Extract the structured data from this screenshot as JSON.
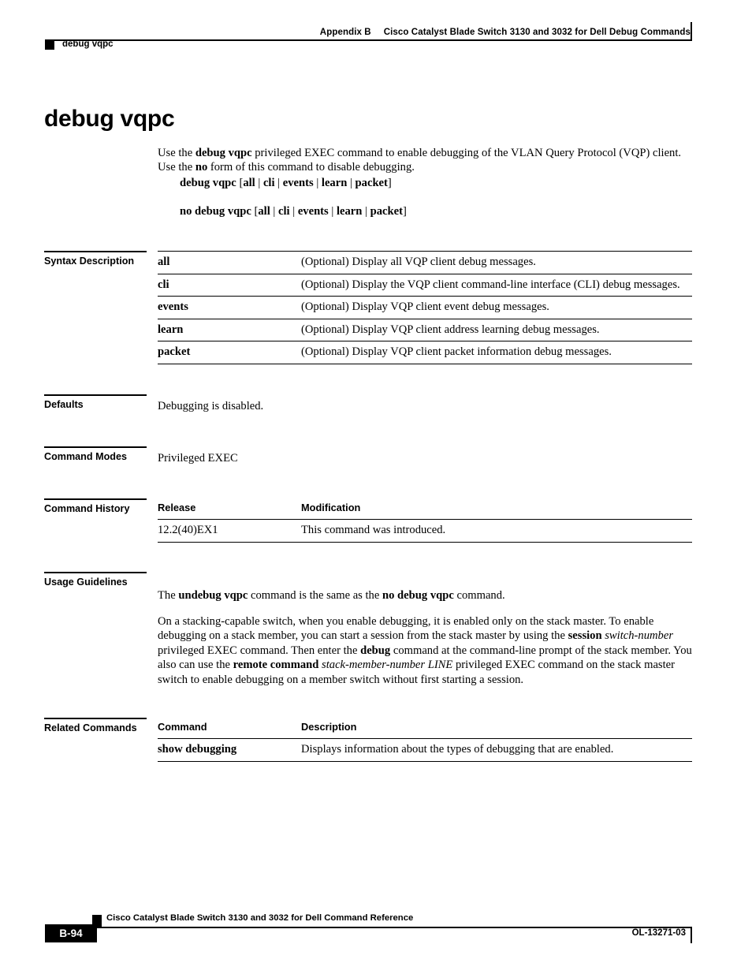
{
  "header": {
    "appendix": "Appendix B",
    "book_title": "Cisco Catalyst Blade Switch 3130 and 3032 for Dell Debug Commands",
    "running_command": "debug vqpc"
  },
  "title": "debug vqpc",
  "intro": {
    "part1": "Use the ",
    "command_bold": "debug vqpc",
    "part2": " privileged EXEC command to enable debugging of the VLAN Query Protocol (VQP) client. Use the ",
    "no_bold": "no",
    "part3": " form of this command to disable debugging."
  },
  "syntax_lines": {
    "line1": "debug vqpc [all | cli | events | learn | packet]",
    "line2": "no debug vqpc [all | cli | events | learn | packet]",
    "line1_pre": "debug vqpc ",
    "line2_pre": "no debug vqpc ",
    "bracket_open": "[",
    "bracket_close": "]",
    "bracket_sep": " | ",
    "keywords": [
      "all",
      "cli",
      "events",
      "learn",
      "packet"
    ]
  },
  "sections": {
    "syntax_description": {
      "label": "Syntax Description",
      "rows": [
        {
          "term": "all",
          "desc": "(Optional) Display all VQP client debug messages."
        },
        {
          "term": "cli",
          "desc": "(Optional) Display the VQP client command-line interface (CLI) debug messages."
        },
        {
          "term": "events",
          "desc": "(Optional) Display VQP client event debug messages."
        },
        {
          "term": "learn",
          "desc": "(Optional) Display VQP client address learning debug messages."
        },
        {
          "term": "packet",
          "desc": "(Optional) Display VQP client packet information debug messages."
        }
      ]
    },
    "defaults": {
      "label": "Defaults",
      "text": "Debugging is disabled."
    },
    "command_modes": {
      "label": "Command Modes",
      "text": "Privileged EXEC"
    },
    "command_history": {
      "label": "Command History",
      "headers": {
        "col1": "Release",
        "col2": "Modification"
      },
      "rows": [
        {
          "release": "12.2(40)EX1",
          "modification": "This command was introduced."
        }
      ]
    },
    "usage_guidelines": {
      "label": "Usage Guidelines",
      "p1": {
        "a": "The ",
        "undebug_bold": "undebug vqpc",
        "b": " command is the same as the ",
        "nodebug_bold": "no debug vqpc",
        "c": " command."
      },
      "p2": {
        "a": "On a stacking-capable switch, when you enable debugging, it is enabled only on the stack master. To enable debugging on a stack member, you can start a session from the stack master by using the ",
        "session_bold": "session",
        "b": " ",
        "switch_number_italic": "switch-number",
        "c": " privileged EXEC command. Then enter the ",
        "debug_bold": "debug",
        "d": " command at the command-line prompt of the stack member. You also can use the ",
        "remote_bold": "remote command",
        "e": " ",
        "stack_member_italic": "stack-member-number LINE",
        "f": " privileged EXEC command on the stack master switch to enable debugging on a member switch without first starting a session."
      }
    },
    "related_commands": {
      "label": "Related Commands",
      "headers": {
        "col1": "Command",
        "col2": "Description"
      },
      "rows": [
        {
          "command": "show debugging",
          "description": "Displays information about the types of debugging that are enabled."
        }
      ]
    }
  },
  "footer": {
    "book_title": "Cisco Catalyst Blade Switch 3130 and 3032 for Dell Command Reference",
    "page_number": "B-94",
    "doc_id": "OL-13271-03"
  }
}
